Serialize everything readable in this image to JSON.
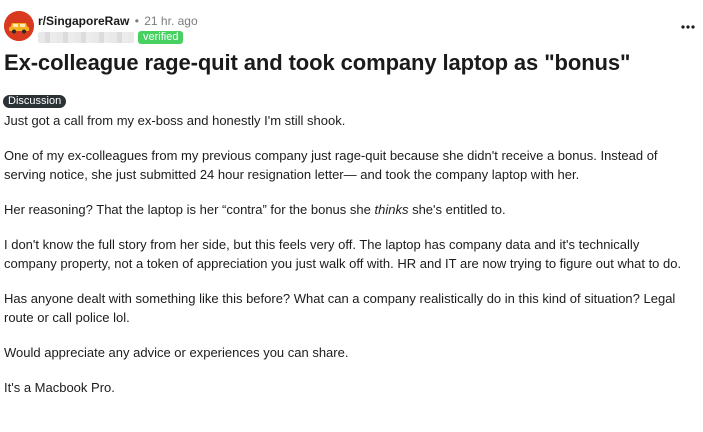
{
  "post": {
    "subreddit": "r/SingaporeRaw",
    "separator": "•",
    "time_ago": "21 hr. ago",
    "verified_label": "verified",
    "title": "Ex-colleague rage-quit and took company laptop as \"bonus\"",
    "flair": "Discussion",
    "paragraphs": {
      "p1": "Just got a call from my ex-boss and honestly I'm still shook.",
      "p2": "One of my ex-colleagues from my previous company just rage-quit because she didn't receive a bonus. Instead of serving notice, she just submitted 24 hour resignation letter— and took the company laptop with her.",
      "p3_before": "Her reasoning? That the laptop is her “contra” for the bonus she ",
      "p3_emphasis": "thinks",
      "p3_after": " she's entitled to.",
      "p4": "I don't know the full story from her side, but this feels very off. The laptop has company data and it's technically company property, not a token of appreciation you just walk off with. HR and IT are now trying to figure out what to do.",
      "p5": "Has anyone dealt with something like this before? What can a company realistically do in this kind of situation? Legal route or call police lol.",
      "p6": "Would appreciate any advice or experiences you can share.",
      "p7": "It's a Macbook Pro."
    }
  },
  "icons": {
    "avatar": "subreddit-avatar",
    "menu": "more-options-icon"
  },
  "colors": {
    "verified": "#46d160",
    "flair_bg": "#2a3236",
    "avatar_bg": "#d93a1f"
  }
}
